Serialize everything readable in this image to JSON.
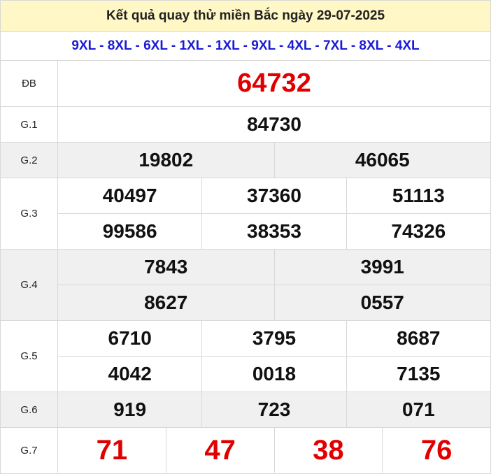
{
  "header": {
    "title": "Kết quả quay thử miền Bắc ngày 29-07-2025",
    "codes": "9XL - 8XL - 6XL - 1XL - 1XL - 9XL - 4XL - 7XL - 8XL - 4XL"
  },
  "prizes": {
    "db": {
      "label": "ĐB",
      "values": [
        "64732"
      ]
    },
    "g1": {
      "label": "G.1",
      "values": [
        "84730"
      ]
    },
    "g2": {
      "label": "G.2",
      "values": [
        "19802",
        "46065"
      ]
    },
    "g3": {
      "label": "G.3",
      "values": [
        "40497",
        "37360",
        "51113",
        "99586",
        "38353",
        "74326"
      ]
    },
    "g4": {
      "label": "G.4",
      "values": [
        "7843",
        "3991",
        "8627",
        "0557"
      ]
    },
    "g5": {
      "label": "G.5",
      "values": [
        "6710",
        "3795",
        "8687",
        "4042",
        "0018",
        "7135"
      ]
    },
    "g6": {
      "label": "G.6",
      "values": [
        "919",
        "723",
        "071"
      ]
    },
    "g7": {
      "label": "G.7",
      "values": [
        "71",
        "47",
        "38",
        "76"
      ]
    }
  },
  "colors": {
    "header_bg": "#fff8c6",
    "codes_text": "#1a1ad6",
    "special_text": "#e00000",
    "shaded_row": "#f0f0f0"
  }
}
